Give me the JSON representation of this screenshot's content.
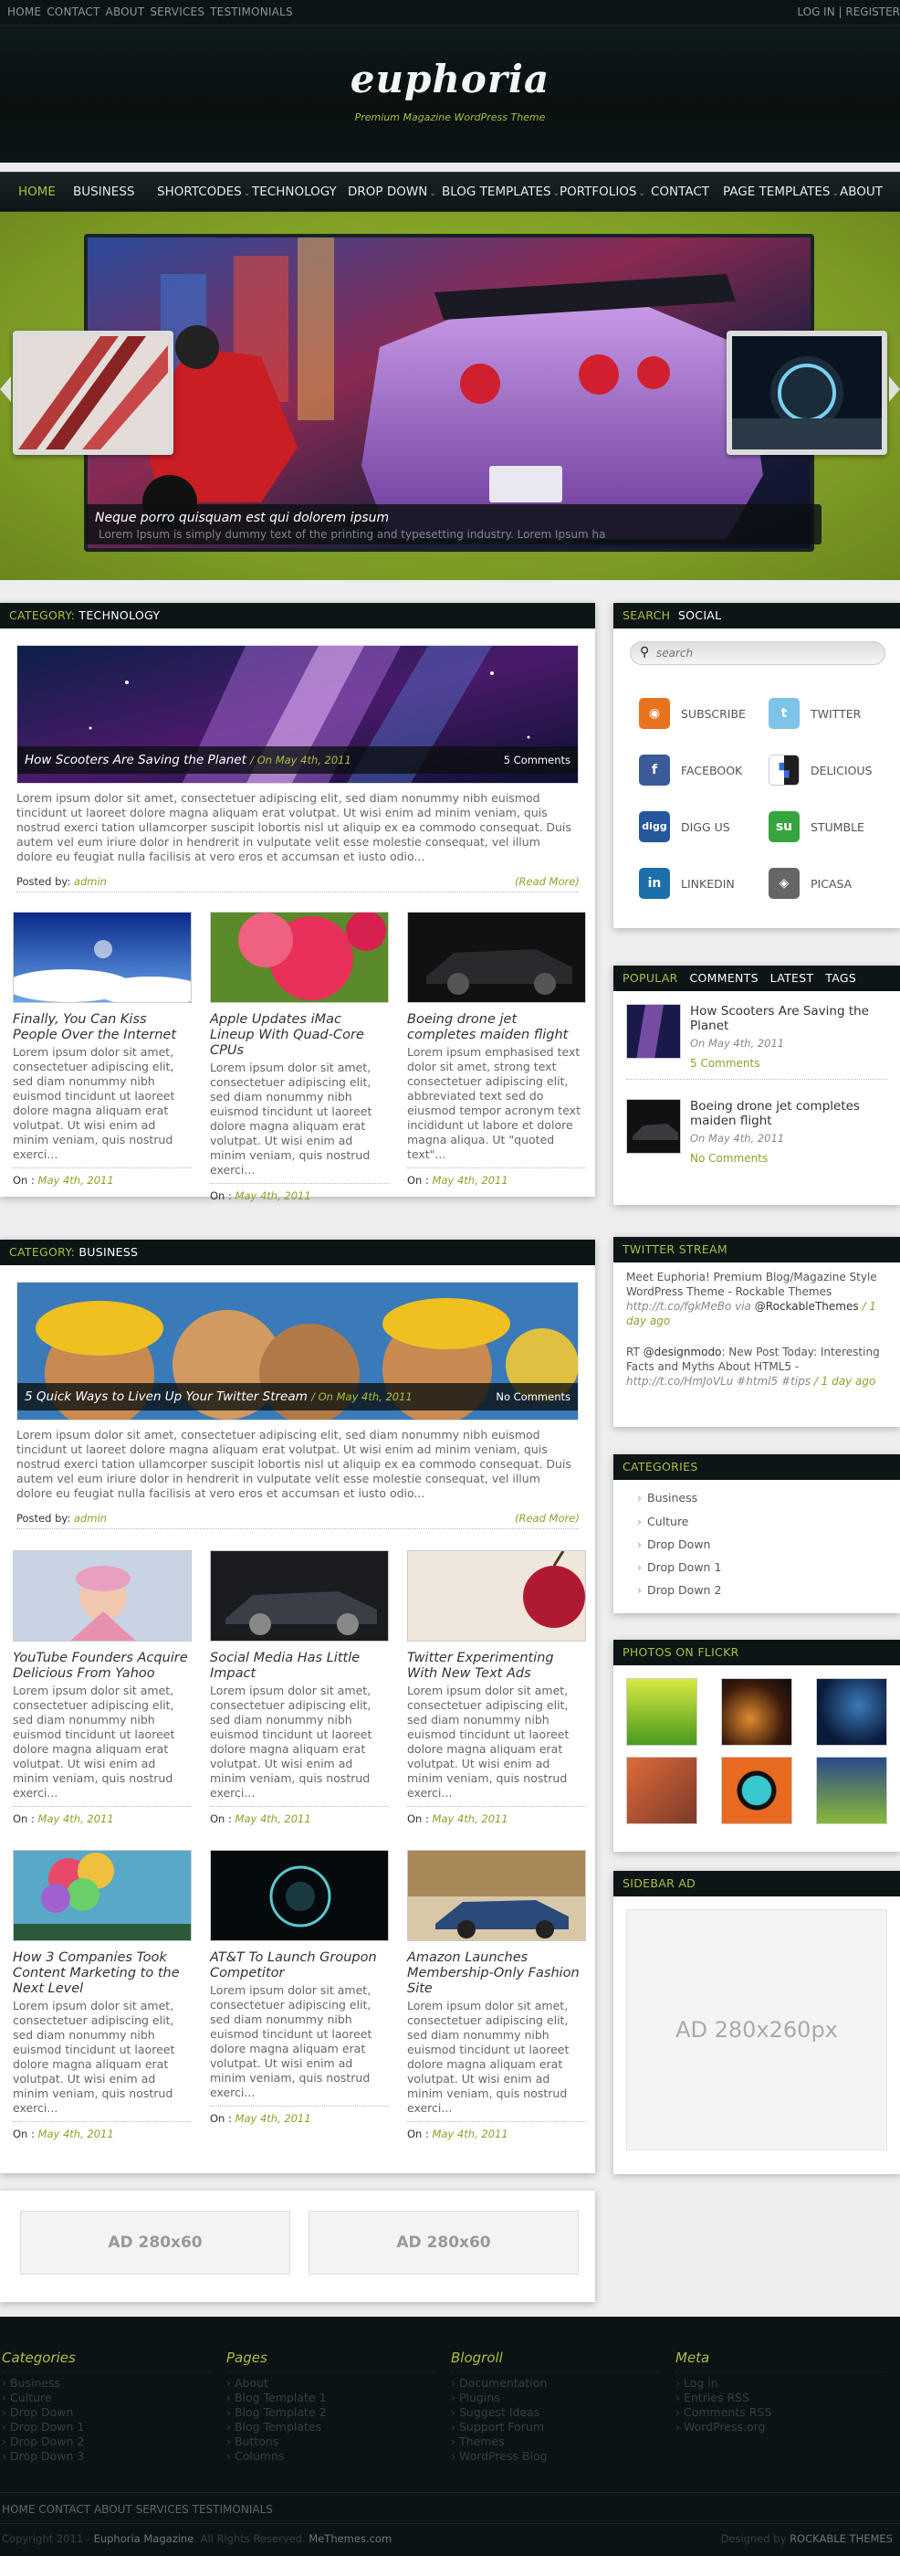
{
  "topbar": {
    "links": [
      "HOME",
      "CONTACT",
      "ABOUT",
      "SERVICES",
      "TESTIMONIALS"
    ],
    "login": "LOG IN",
    "register": "REGISTER"
  },
  "header": {
    "logo": "euphoria",
    "tagline": "Premium Magazine WordPress Theme"
  },
  "menu": [
    {
      "label": "HOME",
      "active": true,
      "dropdown": false
    },
    {
      "label": "BUSINESS",
      "active": false,
      "dropdown": false
    },
    {
      "label": "SHORTCODES",
      "active": false,
      "dropdown": true
    },
    {
      "label": "TECHNOLOGY",
      "active": false,
      "dropdown": false
    },
    {
      "label": "DROP DOWN",
      "active": false,
      "dropdown": true
    },
    {
      "label": "BLOG TEMPLATES",
      "active": false,
      "dropdown": true
    },
    {
      "label": "PORTFOLIOS",
      "active": false,
      "dropdown": true
    },
    {
      "label": "CONTACT",
      "active": false,
      "dropdown": false
    },
    {
      "label": "PAGE TEMPLATES",
      "active": false,
      "dropdown": true
    },
    {
      "label": "ABOUT",
      "active": false,
      "dropdown": false
    }
  ],
  "slider": {
    "caption_title": "Neque porro quisquam est qui dolorem ipsum",
    "caption_text": "Lorem Ipsum is simply dummy text of the printing and typesetting industry. Lorem Ipsum ha"
  },
  "tech": {
    "label": "CATEGORY:",
    "name": "TECHNOLOGY",
    "featured": {
      "title": "How Scooters Are Saving the Planet",
      "date": "/ On May 4th, 2011",
      "comments": "5 Comments"
    },
    "excerpt": "Lorem ipsum dolor sit amet, consectetuer adipiscing elit, sed diam nonummy nibh euismod tincidunt ut laoreet dolore magna aliquam erat volutpat. Ut wisi enim ad minim veniam, quis nostrud exerci tation ullamcorper suscipit lobortis nisl ut aliquip ex ea commodo consequat. Duis autem vel eum iriure dolor in hendrerit in vulputate velit esse molestie consequat, vel illum dolore eu feugiat nulla facilisis at vero eros et accumsan et iusto odio...",
    "posted_by": "Posted by:",
    "author": "admin",
    "read_more": "(Read More)",
    "posts": [
      {
        "title": "Finally, You Can Kiss People Over the Internet",
        "excerpt": "Lorem ipsum dolor sit amet, consectetuer adipiscing elit, sed diam nonummy nibh euismod tincidunt ut laoreet dolore magna aliquam erat volutpat. Ut wisi enim ad minim veniam, quis nostrud exerci...",
        "on": "On :",
        "date": "May 4th, 2011"
      },
      {
        "title": "Apple Updates iMac Lineup With Quad-Core CPUs",
        "excerpt": "Lorem ipsum dolor sit amet, consectetuer adipiscing elit, sed diam nonummy nibh euismod tincidunt ut laoreet dolore magna aliquam erat volutpat. Ut wisi enim ad minim veniam, quis nostrud exerci...",
        "on": "On :",
        "date": "May 4th, 2011"
      },
      {
        "title": "Boeing drone jet completes maiden flight",
        "excerpt": "Lorem ipsum emphasised text dolor sit amet, strong text consectetuer adipiscing elit, abbreviated text sed do eiusmod tempor acronym text incididunt ut labore et dolore magna aliqua. Ut \"quoted text\"...",
        "on": "On :",
        "date": "May 4th, 2011"
      }
    ]
  },
  "business": {
    "label": "CATEGORY:",
    "name": "BUSINESS",
    "featured": {
      "title": "5 Quick Ways to Liven Up Your Twitter Stream",
      "date": "/ On May 4th, 2011",
      "comments": "No Comments"
    },
    "excerpt": "Lorem ipsum dolor sit amet, consectetuer adipiscing elit, sed diam nonummy nibh euismod tincidunt ut laoreet dolore magna aliquam erat volutpat. Ut wisi enim ad minim veniam, quis nostrud exerci tation ullamcorper suscipit lobortis nisl ut aliquip ex ea commodo consequat. Duis autem vel eum iriure dolor in hendrerit in vulputate velit esse molestie consequat, vel illum dolore eu feugiat nulla facilisis at vero eros et accumsan et iusto odio...",
    "posted_by": "Posted by:",
    "author": "admin",
    "read_more": "(Read More)",
    "posts": [
      {
        "title": "YouTube Founders Acquire Delicious From Yahoo",
        "excerpt": "Lorem ipsum dolor sit amet, consectetuer adipiscing elit, sed diam nonummy nibh euismod tincidunt ut laoreet dolore magna aliquam erat volutpat. Ut wisi enim ad minim veniam, quis nostrud exerci...",
        "on": "On :",
        "date": "May 4th, 2011"
      },
      {
        "title": "Social Media Has Little Impact",
        "excerpt": "Lorem ipsum dolor sit amet, consectetuer adipiscing elit, sed diam nonummy nibh euismod tincidunt ut laoreet dolore magna aliquam erat volutpat. Ut wisi enim ad minim veniam, quis nostrud exerci...",
        "on": "On :",
        "date": "May 4th, 2011"
      },
      {
        "title": "Twitter Experimenting With New Text Ads",
        "excerpt": "Lorem ipsum dolor sit amet, consectetuer adipiscing elit, sed diam nonummy nibh euismod tincidunt ut laoreet dolore magna aliquam erat volutpat. Ut wisi enim ad minim veniam, quis nostrud exerci...",
        "on": "On :",
        "date": "May 4th, 2011"
      },
      {
        "title": "How 3 Companies Took Content Marketing to the Next Level",
        "excerpt": "Lorem ipsum dolor sit amet, consectetuer adipiscing elit, sed diam nonummy nibh euismod tincidunt ut laoreet dolore magna aliquam erat volutpat. Ut wisi enim ad minim veniam, quis nostrud exerci...",
        "on": "On :",
        "date": "May 4th, 2011"
      },
      {
        "title": "AT&T To Launch Groupon Competitor",
        "excerpt": "Lorem ipsum dolor sit amet, consectetuer adipiscing elit, sed diam nonummy nibh euismod tincidunt ut laoreet dolore magna aliquam erat volutpat. Ut wisi enim ad minim veniam, quis nostrud exerci...",
        "on": "On :",
        "date": "May 4th, 2011"
      },
      {
        "title": "Amazon Launches Membership-Only Fashion Site",
        "excerpt": "Lorem ipsum dolor sit amet, consectetuer adipiscing elit, sed diam nonummy nibh euismod tincidunt ut laoreet dolore magna aliquam erat volutpat. Ut wisi enim ad minim veniam, quis nostrud exerci...",
        "on": "On :",
        "date": "May 4th, 2011"
      }
    ]
  },
  "ads": {
    "banner1": "AD 280x60",
    "banner2": "AD 280x60",
    "sidebar": "AD 280x260px"
  },
  "sidebar": {
    "search": {
      "tab1": "SEARCH",
      "tab2": "SOCIAL",
      "placeholder": "search"
    },
    "social": [
      {
        "label": "SUBSCRIBE",
        "icon": "rss-icon",
        "color": "#e8731f",
        "glyph": "◉"
      },
      {
        "label": "TWITTER",
        "icon": "twitter-icon",
        "color": "#7ec3e8",
        "glyph": "t"
      },
      {
        "label": "FACEBOOK",
        "icon": "facebook-icon",
        "color": "#3b5a98",
        "glyph": "f"
      },
      {
        "label": "DELICIOUS",
        "icon": "delicious-icon",
        "color": "#1f1f1f",
        "glyph": "▚"
      },
      {
        "label": "DIGG US",
        "icon": "digg-icon",
        "color": "#25579b",
        "glyph": "digg"
      },
      {
        "label": "STUMBLE",
        "icon": "stumbleupon-icon",
        "color": "#36a53e",
        "glyph": "su"
      },
      {
        "label": "LINKEDIN",
        "icon": "linkedin-icon",
        "color": "#1c6fa8",
        "glyph": "in"
      },
      {
        "label": "PICASA",
        "icon": "picasa-icon",
        "color": "#666666",
        "glyph": "◈"
      }
    ],
    "tabs": [
      "POPULAR",
      "COMMENTS",
      "LATEST",
      "TAGS"
    ],
    "popular": [
      {
        "title": "How Scooters Are Saving the Planet",
        "date": "On May 4th, 2011",
        "comments": "5 Comments"
      },
      {
        "title": "Boeing drone jet completes maiden flight",
        "date": "On May 4th, 2011",
        "comments": "No Comments"
      }
    ],
    "twitter": {
      "title": "TWITTER STREAM",
      "tweet1": "Meet Euphoria! Premium Blog/Magazine Style WordPress Theme - Rockable Themes",
      "tweet1_link": "http://t.co/fgkMeBo via",
      "tweet1_user": "@RockableThemes",
      "tweet1_time": "/ 1 day ago",
      "tweet2_rt": "RT",
      "tweet2_user": "@designmodo",
      "tweet2_text": ": New Post Today: Interesting Facts and Myths About HTML5 -",
      "tweet2_link": "http://t.co/HmJoVLu #html5 #tips",
      "tweet2_time": "/ 1 day ago"
    },
    "categories": {
      "title": "CATEGORIES",
      "items": [
        "Business",
        "Culture",
        "Drop Down",
        "Drop Down 1",
        "Drop Down 2"
      ]
    },
    "flickr": {
      "title": "PHOTOS ON FLICKR"
    },
    "ad_title": "SIDEBAR AD"
  },
  "footer": {
    "cols": [
      {
        "title": "Categories",
        "items": [
          "Business",
          "Culture",
          "Drop Down",
          "Drop Down 1",
          "Drop Down 2",
          "Drop Down 3"
        ]
      },
      {
        "title": "Pages",
        "items": [
          "About",
          "Blog Template 1",
          "Blog Template 2",
          "Blog Templates",
          "Buttons",
          "Columns"
        ]
      },
      {
        "title": "Blogroll",
        "items": [
          "Documentation",
          "Plugins",
          "Suggest Ideas",
          "Support Forum",
          "Themes",
          "WordPress Blog"
        ]
      },
      {
        "title": "Meta",
        "items": [
          "Log in",
          "Entries RSS",
          "Comments RSS",
          "WordPress.org"
        ]
      }
    ],
    "links": [
      "HOME",
      "CONTACT",
      "ABOUT",
      "SERVICES",
      "TESTIMONIALS"
    ],
    "copyright": "Copyright 2011 -",
    "brand": "Euphoria Magazine",
    "rights": ". All Rights Reserved.",
    "by": "MeThemes.com",
    "designed": "Designed by",
    "designer": "ROCKABLE THEMES"
  },
  "colors": {
    "accent": "#a6c040",
    "dark": "#0d1517",
    "slider_green": "#8aad28"
  }
}
